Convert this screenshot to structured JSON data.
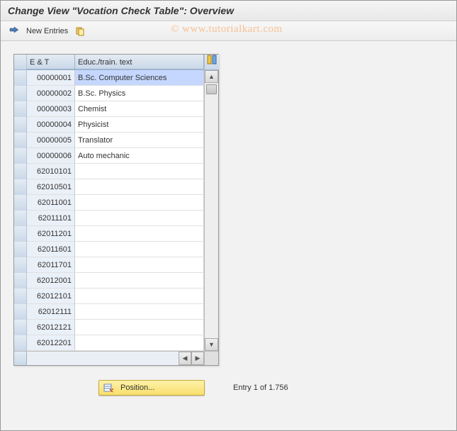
{
  "title": "Change View \"Vocation Check Table\": Overview",
  "watermark": "© www.tutorialkart.com",
  "toolbar": {
    "new_entries_label": "New Entries"
  },
  "table": {
    "header": {
      "key": "E & T",
      "text": "Educ./train. text"
    },
    "rows": [
      {
        "key": "00000001",
        "text": "B.Sc. Computer Sciences",
        "selected": true
      },
      {
        "key": "00000002",
        "text": "B.Sc. Physics"
      },
      {
        "key": "00000003",
        "text": "Chemist"
      },
      {
        "key": "00000004",
        "text": "Physicist"
      },
      {
        "key": "00000005",
        "text": "Translator"
      },
      {
        "key": "00000006",
        "text": "Auto mechanic"
      },
      {
        "key": "62010101",
        "text": ""
      },
      {
        "key": "62010501",
        "text": ""
      },
      {
        "key": "62011001",
        "text": ""
      },
      {
        "key": "62011101",
        "text": ""
      },
      {
        "key": "62011201",
        "text": ""
      },
      {
        "key": "62011601",
        "text": ""
      },
      {
        "key": "62011701",
        "text": ""
      },
      {
        "key": "62012001",
        "text": ""
      },
      {
        "key": "62012101",
        "text": ""
      },
      {
        "key": "62012111",
        "text": ""
      },
      {
        "key": "62012121",
        "text": ""
      },
      {
        "key": "62012201",
        "text": ""
      }
    ]
  },
  "footer": {
    "position_label": "Position...",
    "entry_text": "Entry 1 of 1.756"
  }
}
